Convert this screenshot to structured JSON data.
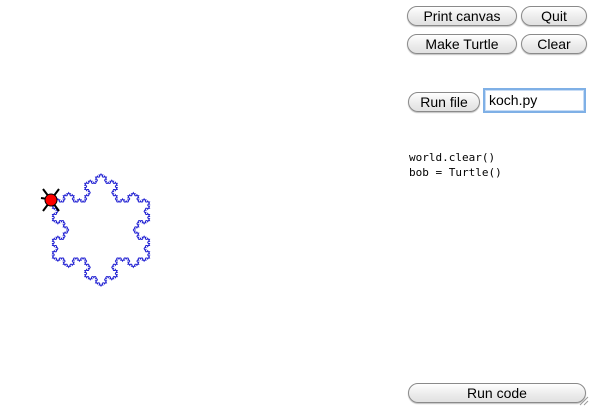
{
  "buttons": {
    "print_canvas": "Print canvas",
    "quit": "Quit",
    "make_turtle": "Make Turtle",
    "clear": "Clear",
    "run_file": "Run file",
    "run_code": "Run code"
  },
  "file_entry": {
    "value": "koch.py"
  },
  "code_text": {
    "lines": [
      "world.clear()",
      "bob = Turtle()"
    ]
  },
  "canvas": {
    "shape": "koch-snowflake",
    "stroke_color": "#1f1fd2",
    "turtle_color": "#ff0000",
    "turtle_icon": "turtle-icon"
  }
}
